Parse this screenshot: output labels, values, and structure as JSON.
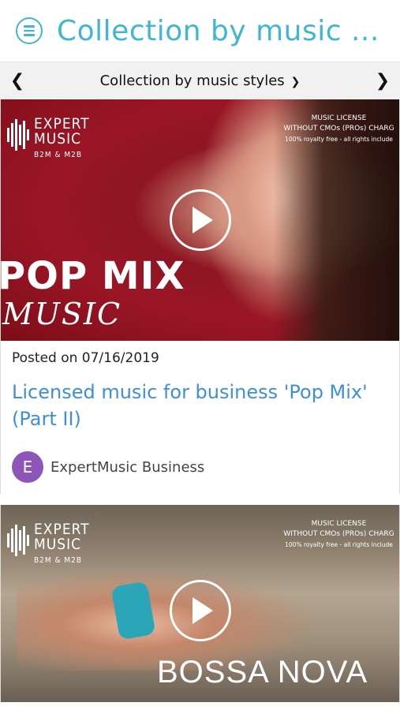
{
  "header": {
    "title": "Collection by music ...",
    "menu_icon": "menu-icon"
  },
  "subnav": {
    "label": "Collection by music styles",
    "prev_icon": "chevron-left-icon",
    "next_icon": "chevron-right-icon",
    "dropdown_icon": "chevron-down-icon"
  },
  "cards": [
    {
      "logo": {
        "line1": "EXPERT",
        "line2": "MUSIC",
        "line3": "B2M & M2B"
      },
      "license": {
        "line1": "MUSIC LICENSE",
        "line2": "WITHOUT CMOs (PROs) CHARG",
        "line3": "100% royalty free - all rights include"
      },
      "genre_main": "POP MIX",
      "genre_sub": "MUSIC",
      "posted": "Posted on 07/16/2019",
      "headline": "Licensed music for business 'Pop Mix' (Part II)",
      "avatar_letter": "E",
      "author": "ExpertMusic Business"
    },
    {
      "logo": {
        "line1": "EXPERT",
        "line2": "MUSIC",
        "line3": "B2M & M2B"
      },
      "license": {
        "line1": "MUSIC LICENSE",
        "line2": "WITHOUT CMOs (PROs) CHARG",
        "line3": "100% royalty free - all rights include"
      },
      "genre_main": "BOSSA NOVA"
    }
  ],
  "colors": {
    "accent": "#3fb7cf",
    "link": "#3f8fd8",
    "avatar": "#8e56b8"
  }
}
